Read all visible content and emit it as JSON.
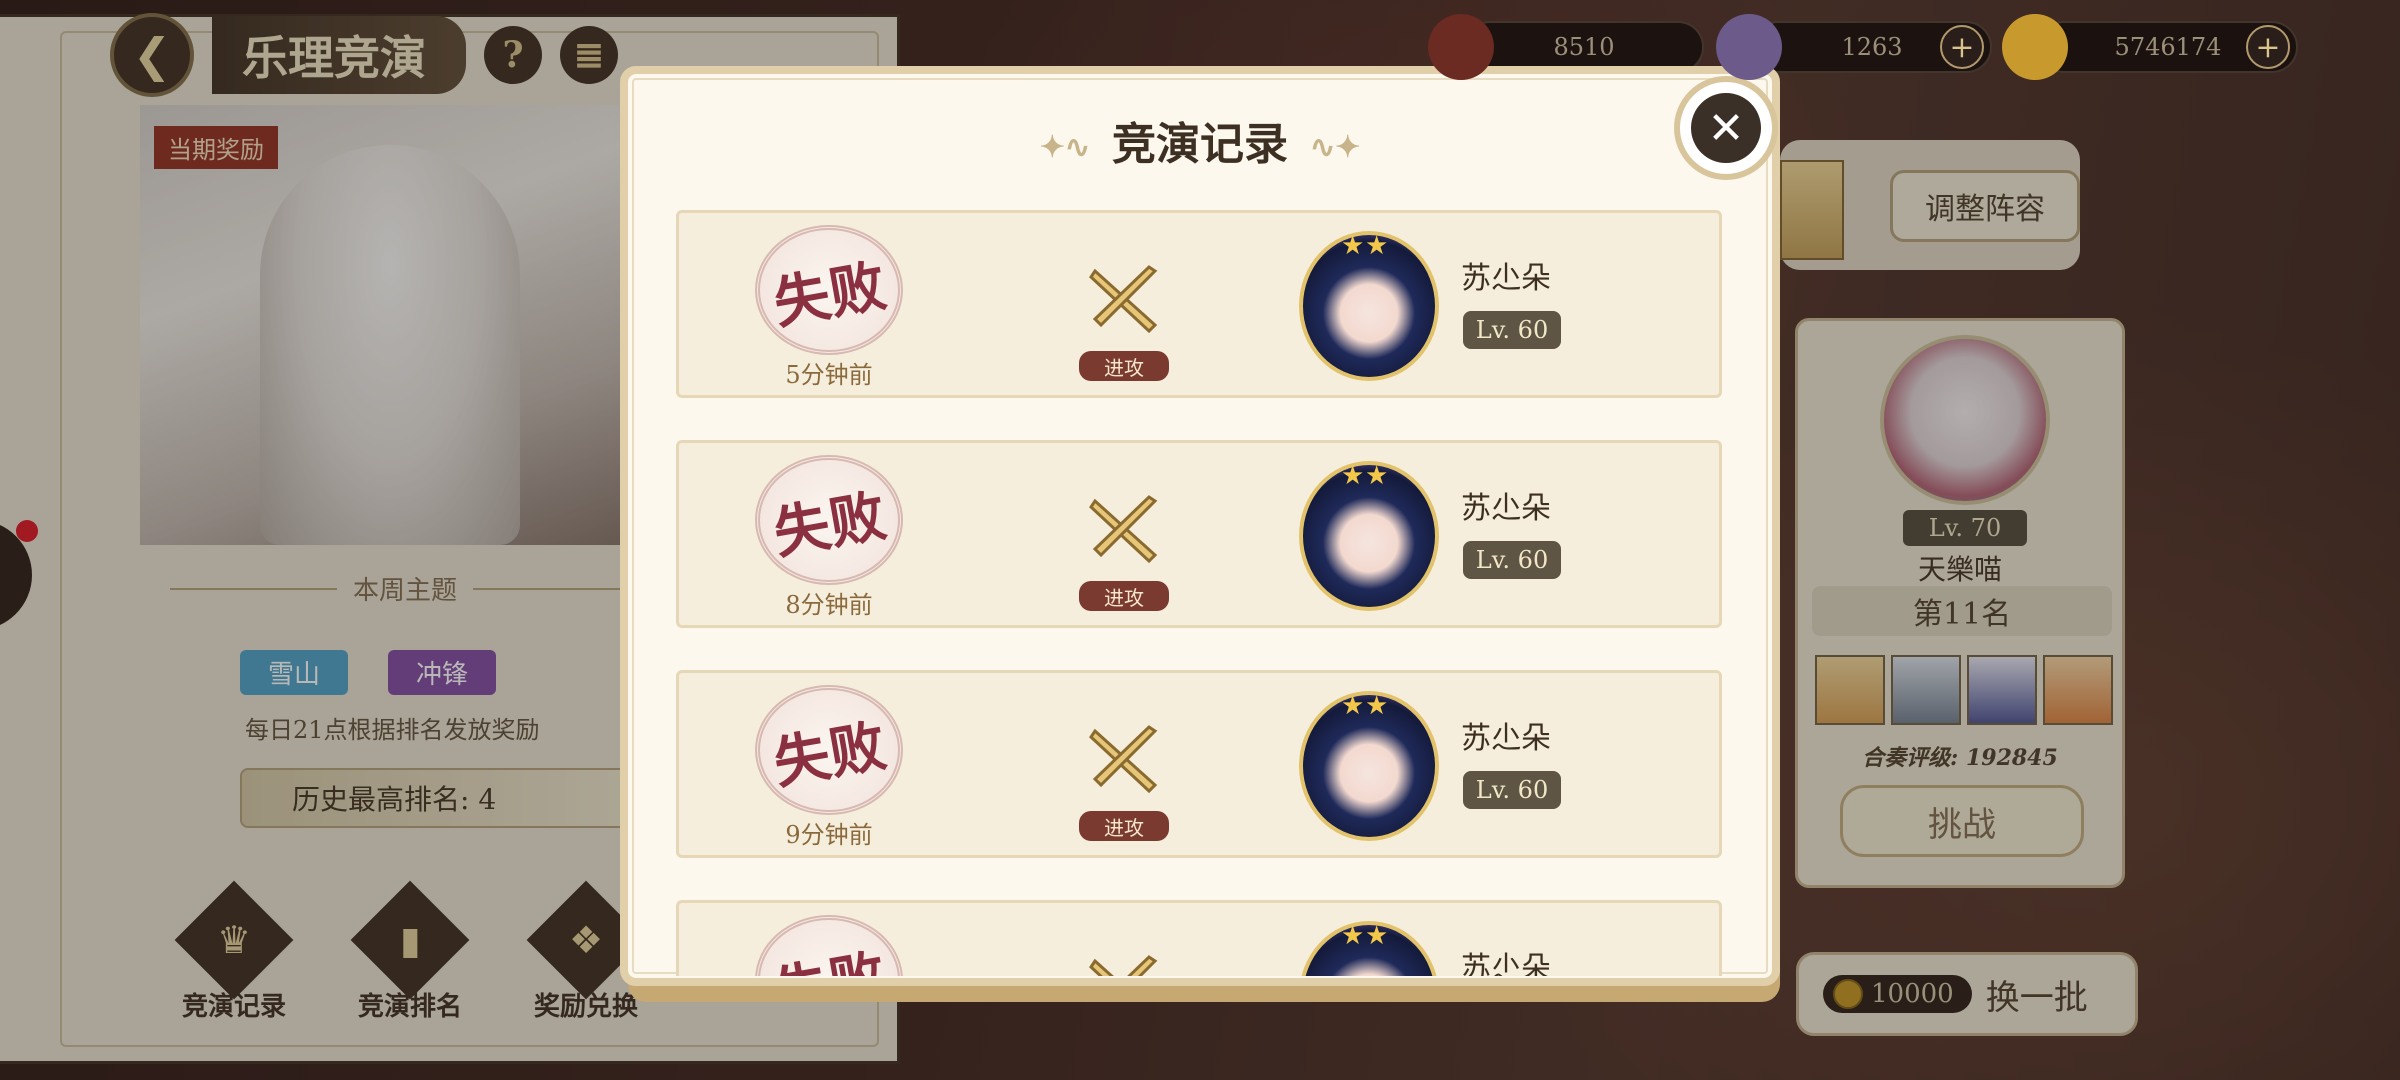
{
  "left": {
    "title": "乐理竞演",
    "reward_tag": "当期奖励",
    "week_theme_label": "本周主题",
    "tags": [
      "雪山",
      "冲锋"
    ],
    "daily_note": "每日21点根据排名发放奖励",
    "best_rank": "历史最高排名: 4",
    "buttons": [
      "竞演记录",
      "竞演排名",
      "奖励兑换"
    ]
  },
  "resources": [
    {
      "icon": "book-currency-icon",
      "value": "8510",
      "has_plus": false
    },
    {
      "icon": "crystal-currency-icon",
      "value": "1263",
      "has_plus": true
    },
    {
      "icon": "gold-coin-icon",
      "value": "5746174",
      "has_plus": true
    }
  ],
  "right": {
    "adjust_label": "调整阵容",
    "opponent": {
      "level": "Lv. 70",
      "name": "天樂喵",
      "rank": "第11名",
      "score": "合奏评级: 192845",
      "challenge_label": "挑战"
    },
    "refresh": {
      "cost": "10000",
      "label": "换一批"
    }
  },
  "modal": {
    "title": "竞演记录",
    "records": [
      {
        "result": "失败",
        "time": "5分钟前",
        "type": "进攻",
        "name": "苏尐朵",
        "level": "Lv. 60"
      },
      {
        "result": "失败",
        "time": "8分钟前",
        "type": "进攻",
        "name": "苏尐朵",
        "level": "Lv. 60"
      },
      {
        "result": "失败",
        "time": "9分钟前",
        "type": "进攻",
        "name": "苏尐朵",
        "level": "Lv. 60"
      },
      {
        "result": "失败",
        "time": "",
        "type": "",
        "name": "苏尐朵",
        "level": ""
      }
    ]
  },
  "colors": {
    "fail": "#8a3040",
    "attack_badge": "#7a3a30",
    "level_badge": "#5e5545",
    "modal_bg": "#fcf8ee"
  }
}
